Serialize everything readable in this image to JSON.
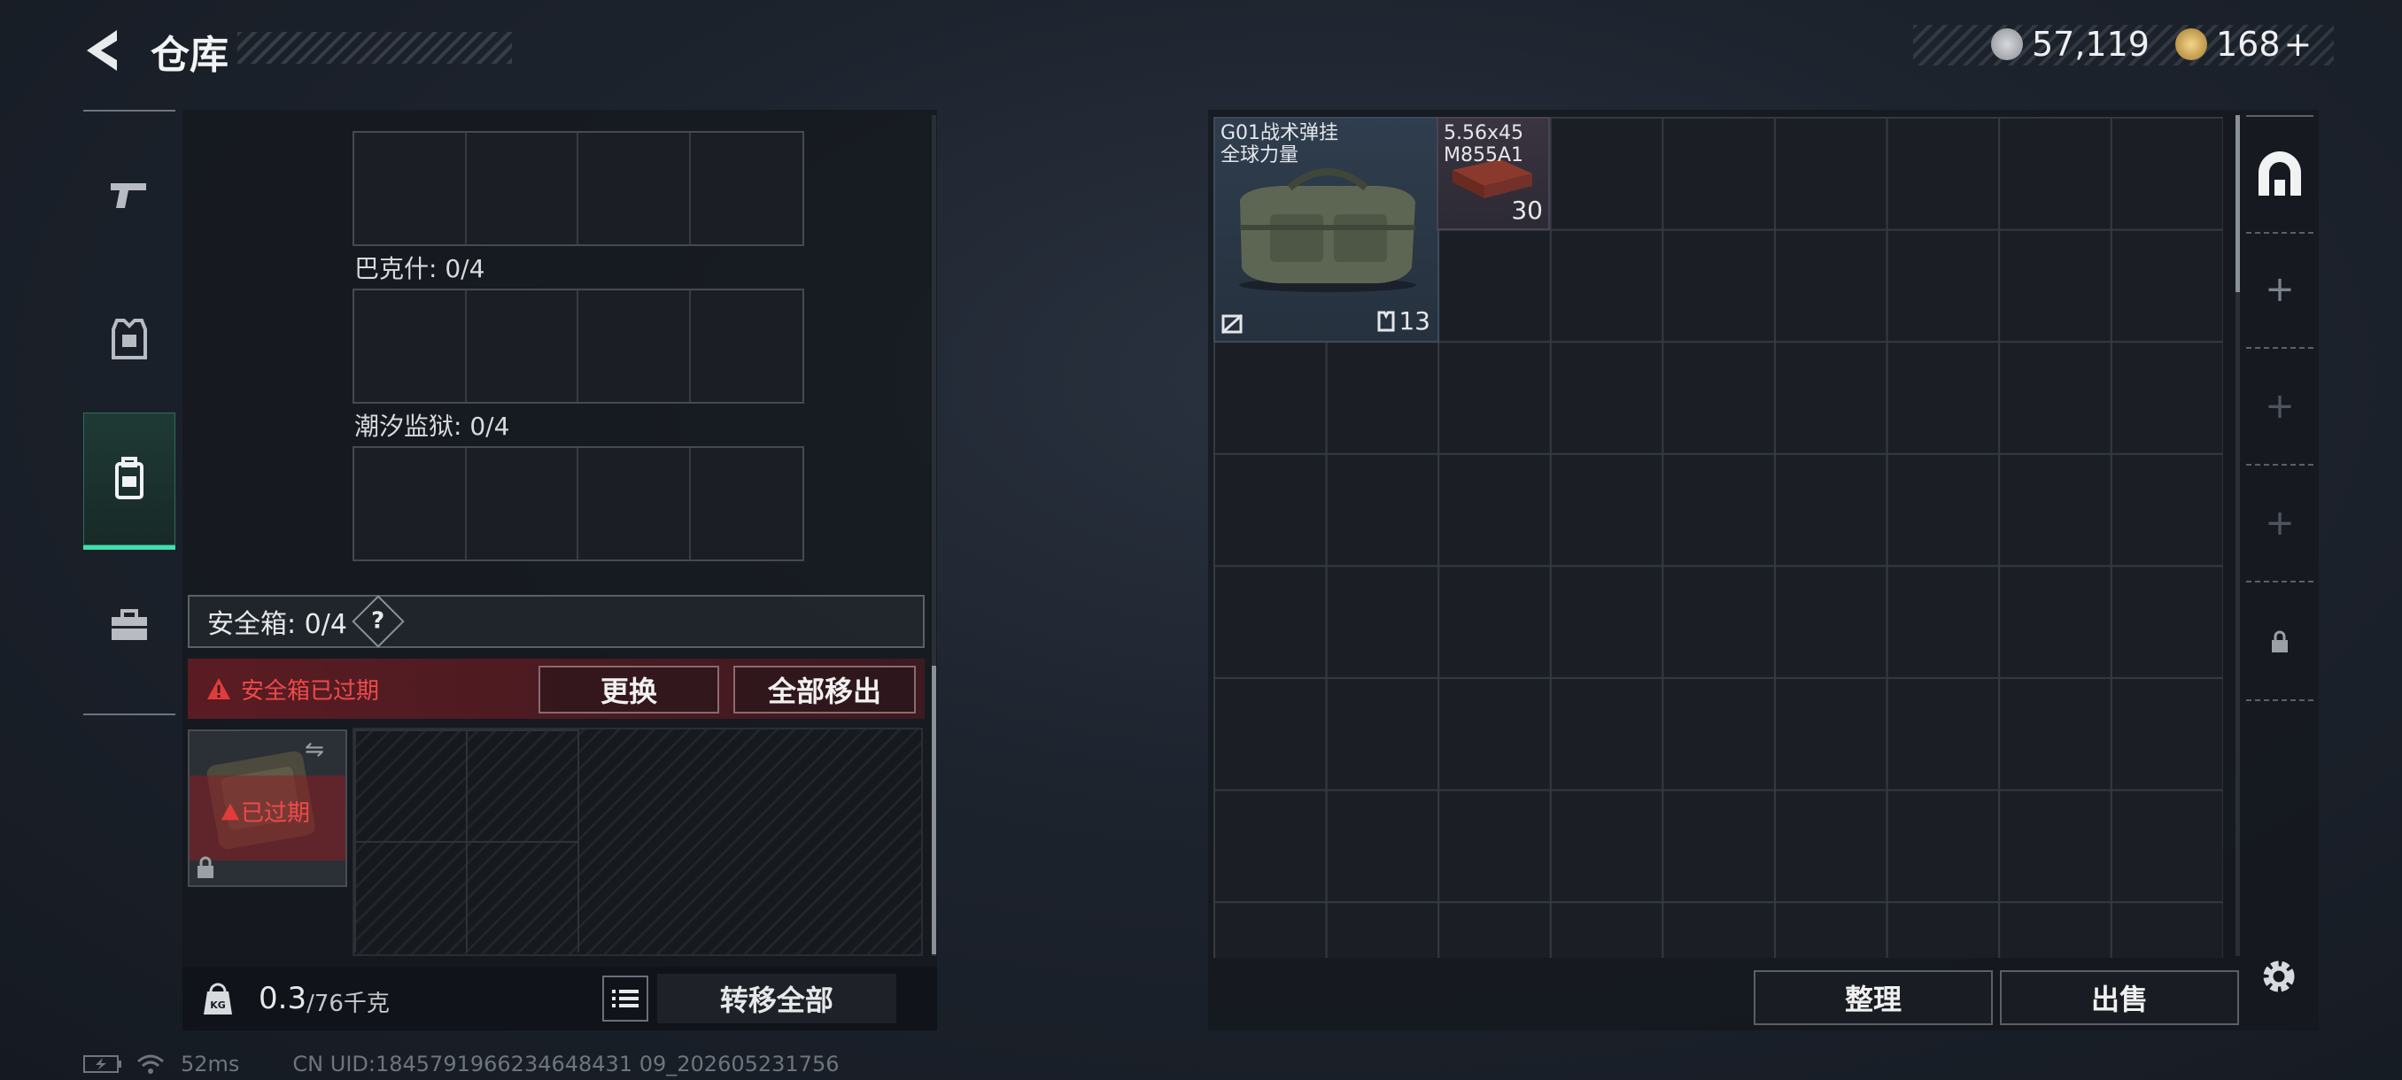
{
  "header": {
    "title": "仓库"
  },
  "currency": [
    {
      "icon": "silver-coin-icon",
      "value": "57,119"
    },
    {
      "icon": "gold-coin-icon",
      "value": "168",
      "add": "+"
    }
  ],
  "nav": [
    {
      "icon": "gun-icon",
      "active": false
    },
    {
      "icon": "armor-vest-icon",
      "active": false
    },
    {
      "icon": "backpack-icon",
      "active": true
    },
    {
      "icon": "toolbox-icon",
      "active": false
    }
  ],
  "left_panel": {
    "sections": [
      {
        "label": "巴克什: 0/4"
      },
      {
        "label": "潮汐监狱: 0/4"
      }
    ],
    "safebox": {
      "title": "安全箱: 0/4",
      "help": "?",
      "expired_text": "安全箱已过期",
      "replace_label": "更换",
      "move_all_label": "全部移出",
      "thumb_badge": "已过期"
    },
    "weight": {
      "current": "0.3",
      "max": "/76千克"
    },
    "transfer_all_label": "转移全部"
  },
  "items": [
    {
      "name_line1": "G01战术弹挂",
      "name_line2": "全球力量",
      "count": "13"
    },
    {
      "name_line1": "5.56x45",
      "name_line2": "M855A1",
      "count": "30"
    }
  ],
  "right_panel": {
    "sort_label": "整理",
    "sell_label": "出售"
  },
  "status_bar": {
    "ping": "52ms",
    "uid": "CN UID:1845791966234648431 09_202605231756"
  },
  "colors": {
    "accent": "#3fe0b0",
    "warning": "#e23b3b"
  }
}
